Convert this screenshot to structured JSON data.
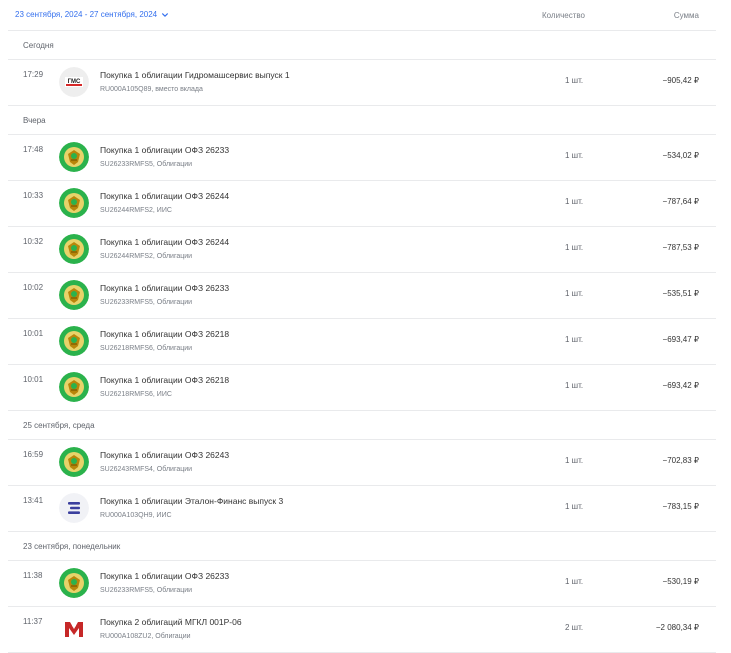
{
  "header": {
    "date_range": "23 сентября, 2024 - 27 сентября, 2024",
    "col_quantity": "Количество",
    "col_sum": "Сумма"
  },
  "colors": {
    "accent": "#336fee",
    "ofz_green": "#2bb24c",
    "ofz_gold": "#c9a227"
  },
  "groups": [
    {
      "label": "Сегодня",
      "rows": [
        {
          "time": "17:29",
          "icon": "gms-logo-icon",
          "title": "Покупка 1 облигации Гидромашсервис выпуск 1",
          "sub": "RU000A105Q89, вместо вклада",
          "qty": "1 шт.",
          "amount": "−905,42 ₽"
        }
      ]
    },
    {
      "label": "Вчера",
      "rows": [
        {
          "time": "17:48",
          "icon": "ofz-emblem-icon",
          "title": "Покупка 1 облигации ОФЗ 26233",
          "sub": "SU26233RMFS5, Облигации",
          "qty": "1 шт.",
          "amount": "−534,02 ₽"
        },
        {
          "time": "10:33",
          "icon": "ofz-emblem-icon",
          "title": "Покупка 1 облигации ОФЗ 26244",
          "sub": "SU26244RMFS2, ИИС",
          "qty": "1 шт.",
          "amount": "−787,64 ₽"
        },
        {
          "time": "10:32",
          "icon": "ofz-emblem-icon",
          "title": "Покупка 1 облигации ОФЗ 26244",
          "sub": "SU26244RMFS2, Облигации",
          "qty": "1 шт.",
          "amount": "−787,53 ₽"
        },
        {
          "time": "10:02",
          "icon": "ofz-emblem-icon",
          "title": "Покупка 1 облигации ОФЗ 26233",
          "sub": "SU26233RMFS5, Облигации",
          "qty": "1 шт.",
          "amount": "−535,51 ₽"
        },
        {
          "time": "10:01",
          "icon": "ofz-emblem-icon",
          "title": "Покупка 1 облигации ОФЗ 26218",
          "sub": "SU26218RMFS6, Облигации",
          "qty": "1 шт.",
          "amount": "−693,47 ₽"
        },
        {
          "time": "10:01",
          "icon": "ofz-emblem-icon",
          "title": "Покупка 1 облигации ОФЗ 26218",
          "sub": "SU26218RMFS6, ИИС",
          "qty": "1 шт.",
          "amount": "−693,42 ₽"
        }
      ]
    },
    {
      "label": "25 сентября, среда",
      "rows": [
        {
          "time": "16:59",
          "icon": "ofz-emblem-icon",
          "title": "Покупка 1 облигации ОФЗ 26243",
          "sub": "SU26243RMFS4, Облигации",
          "qty": "1 шт.",
          "amount": "−702,83 ₽"
        },
        {
          "time": "13:41",
          "icon": "etalon-logo-icon",
          "title": "Покупка 1 облигации Эталон-Финанс выпуск 3",
          "sub": "RU000A103QH9, ИИС",
          "qty": "1 шт.",
          "amount": "−783,15 ₽"
        }
      ]
    },
    {
      "label": "23 сентября, понедельник",
      "rows": [
        {
          "time": "11:38",
          "icon": "ofz-emblem-icon",
          "title": "Покупка 1 облигации ОФЗ 26233",
          "sub": "SU26233RMFS5, Облигации",
          "qty": "1 шт.",
          "amount": "−530,19 ₽"
        },
        {
          "time": "11:37",
          "icon": "mgkl-logo-icon",
          "title": "Покупка 2 облигаций МГКЛ 001Р-06",
          "sub": "RU000A108ZU2, Облигации",
          "qty": "2 шт.",
          "amount": "−2 080,34 ₽"
        }
      ]
    }
  ]
}
